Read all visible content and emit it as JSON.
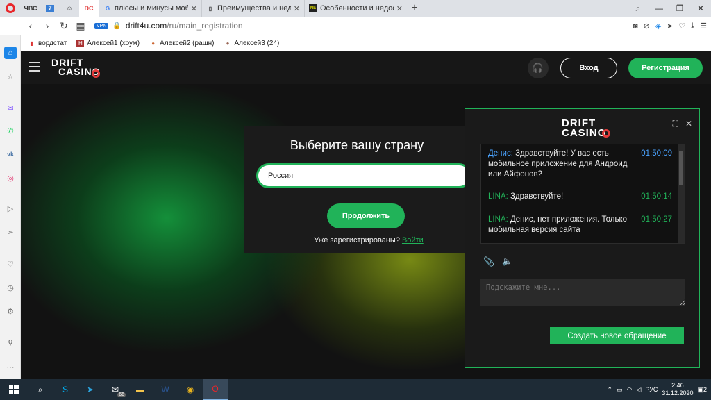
{
  "browser": {
    "pinned_tabs": [
      "ЧВС",
      "7",
      "☺",
      "DC"
    ],
    "tabs": [
      {
        "label": "плюсы и минусы мобильн",
        "favicon": "G"
      },
      {
        "label": "Преимущества и недостат",
        "favicon": "doc"
      },
      {
        "label": "Особенности и недостатк",
        "favicon": "NE"
      }
    ],
    "new_tab": "+",
    "address": {
      "vpn": "VPN",
      "domain": "drift4u.com",
      "path": "/ru/main_registration"
    },
    "bookmarks": [
      {
        "label": "вордстат",
        "icon": "chart-icon"
      },
      {
        "label": "Алексей1 (хоум)",
        "icon": "hs-icon"
      },
      {
        "label": "Алексей2 (рашн)",
        "icon": "avatar-icon"
      },
      {
        "label": "Алексей3 (24)",
        "icon": "avatar-icon"
      }
    ]
  },
  "site": {
    "login_label": "Вход",
    "register_label": "Регистрация",
    "logo_line1": "DRIFT",
    "logo_line2": "CASINO"
  },
  "country": {
    "title": "Выберите вашу страну",
    "selected": "Россия",
    "continue_label": "Продолжить",
    "already_text": "Уже зарегистрированы?",
    "login_link": "Войти"
  },
  "chat": {
    "logo_line1": "DRIFT",
    "logo_line2": "CASINO",
    "messages": [
      {
        "author": "Денис:",
        "text": "Здравствуйте! У вас есть мобильное приложение для Андроид или Айфонов?",
        "time": "01:50:09"
      },
      {
        "author": "LINA:",
        "text": "Здравствуйте!",
        "time": "01:50:14"
      },
      {
        "author": "LINA:",
        "text": "Денис, нет приложения. Только мобильная версия сайта",
        "time": "01:50:27"
      }
    ],
    "input_placeholder": "Подскажите мне...",
    "new_ticket_label": "Создать новое обращение"
  },
  "taskbar": {
    "mail_badge": "66",
    "lang": "РУС",
    "time": "2:46",
    "date": "31.12.2020",
    "notifications": "2"
  },
  "colors": {
    "accent": "#21b359",
    "agent": "#4aa3ff",
    "brand_red": "#e23b3b"
  }
}
